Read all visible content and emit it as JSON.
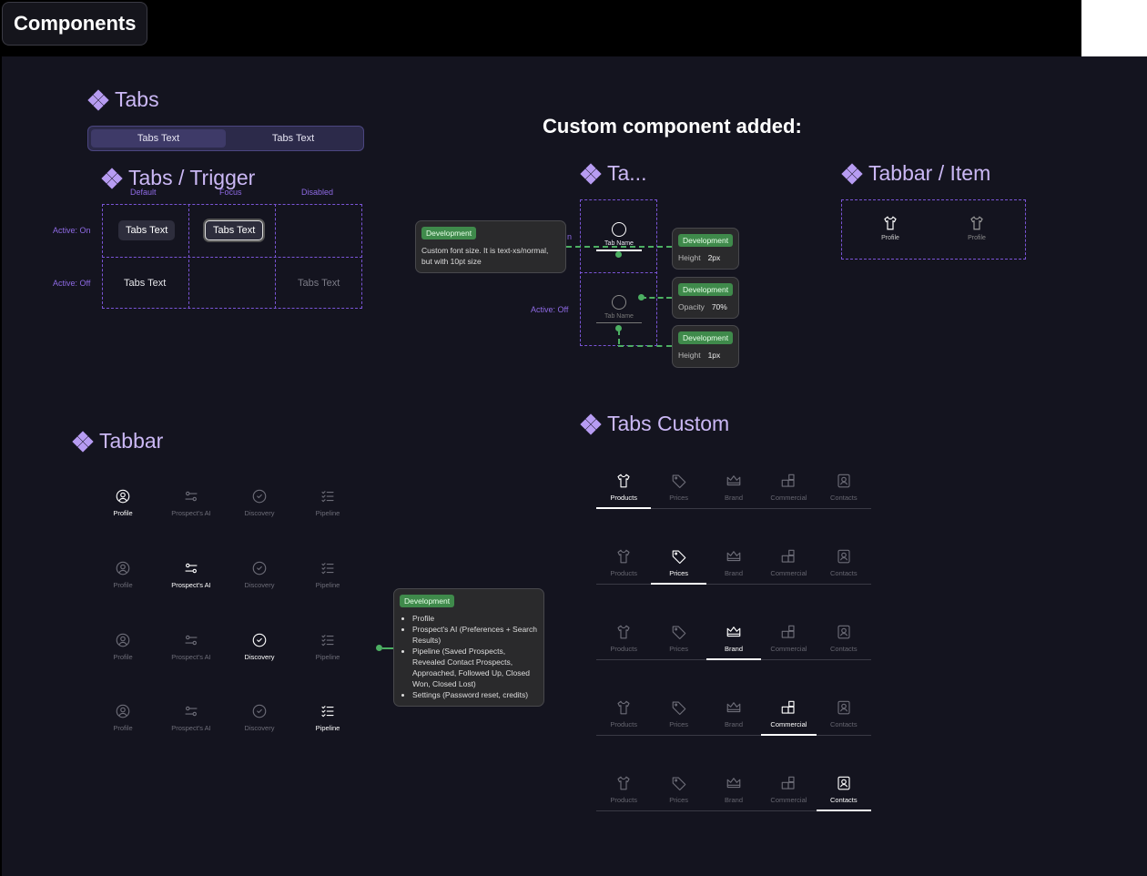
{
  "frame": {
    "title": "Components"
  },
  "headline": "Custom component added:",
  "tabs": {
    "title": "Tabs",
    "items": [
      "Tabs Text",
      "Tabs Text"
    ]
  },
  "trigger": {
    "title": "Tabs / Trigger",
    "columns": [
      "Default",
      "Focus",
      "Disabled"
    ],
    "rows": [
      "Active: On",
      "Active: Off"
    ],
    "cell_text": "Tabs Text"
  },
  "ta": {
    "title": "Ta...",
    "tab_name": "Tab Name",
    "partial_label": "n",
    "active_off": "Active: Off"
  },
  "tooltips": {
    "badge": "Development",
    "font_note": "Custom font size. It is text-xs/normal, but with 10pt size",
    "height_top": {
      "key": "Height",
      "value": "2px"
    },
    "opacity": {
      "key": "Opacity",
      "value": "70%"
    },
    "height_bottom": {
      "key": "Height",
      "value": "1px"
    },
    "tabbar_list": [
      "Profile",
      "Prospect's AI (Preferences + Search Results)",
      "Pipeline (Saved Prospects, Revealed Contact Prospects, Approached, Followed Up, Closed Won, Closed Lost)",
      "Settings (Password reset, credits)"
    ]
  },
  "tabbar_item": {
    "title": "Tabbar / Item",
    "labels": [
      "Profile",
      "Profile"
    ]
  },
  "tabbar": {
    "title": "Tabbar",
    "labels": [
      "Profile",
      "Prospect's AI",
      "Discovery",
      "Pipeline"
    ]
  },
  "tabs_custom": {
    "title": "Tabs Custom",
    "labels": [
      "Products",
      "Prices",
      "Brand",
      "Commercial",
      "Contacts"
    ]
  },
  "icons": [
    "shirt-icon",
    "tag-icon",
    "crown-icon",
    "blocks-icon",
    "contact-icon",
    "user-circle-icon",
    "sliders-icon",
    "search-circle-icon",
    "checklist-icon",
    "component-icon"
  ]
}
